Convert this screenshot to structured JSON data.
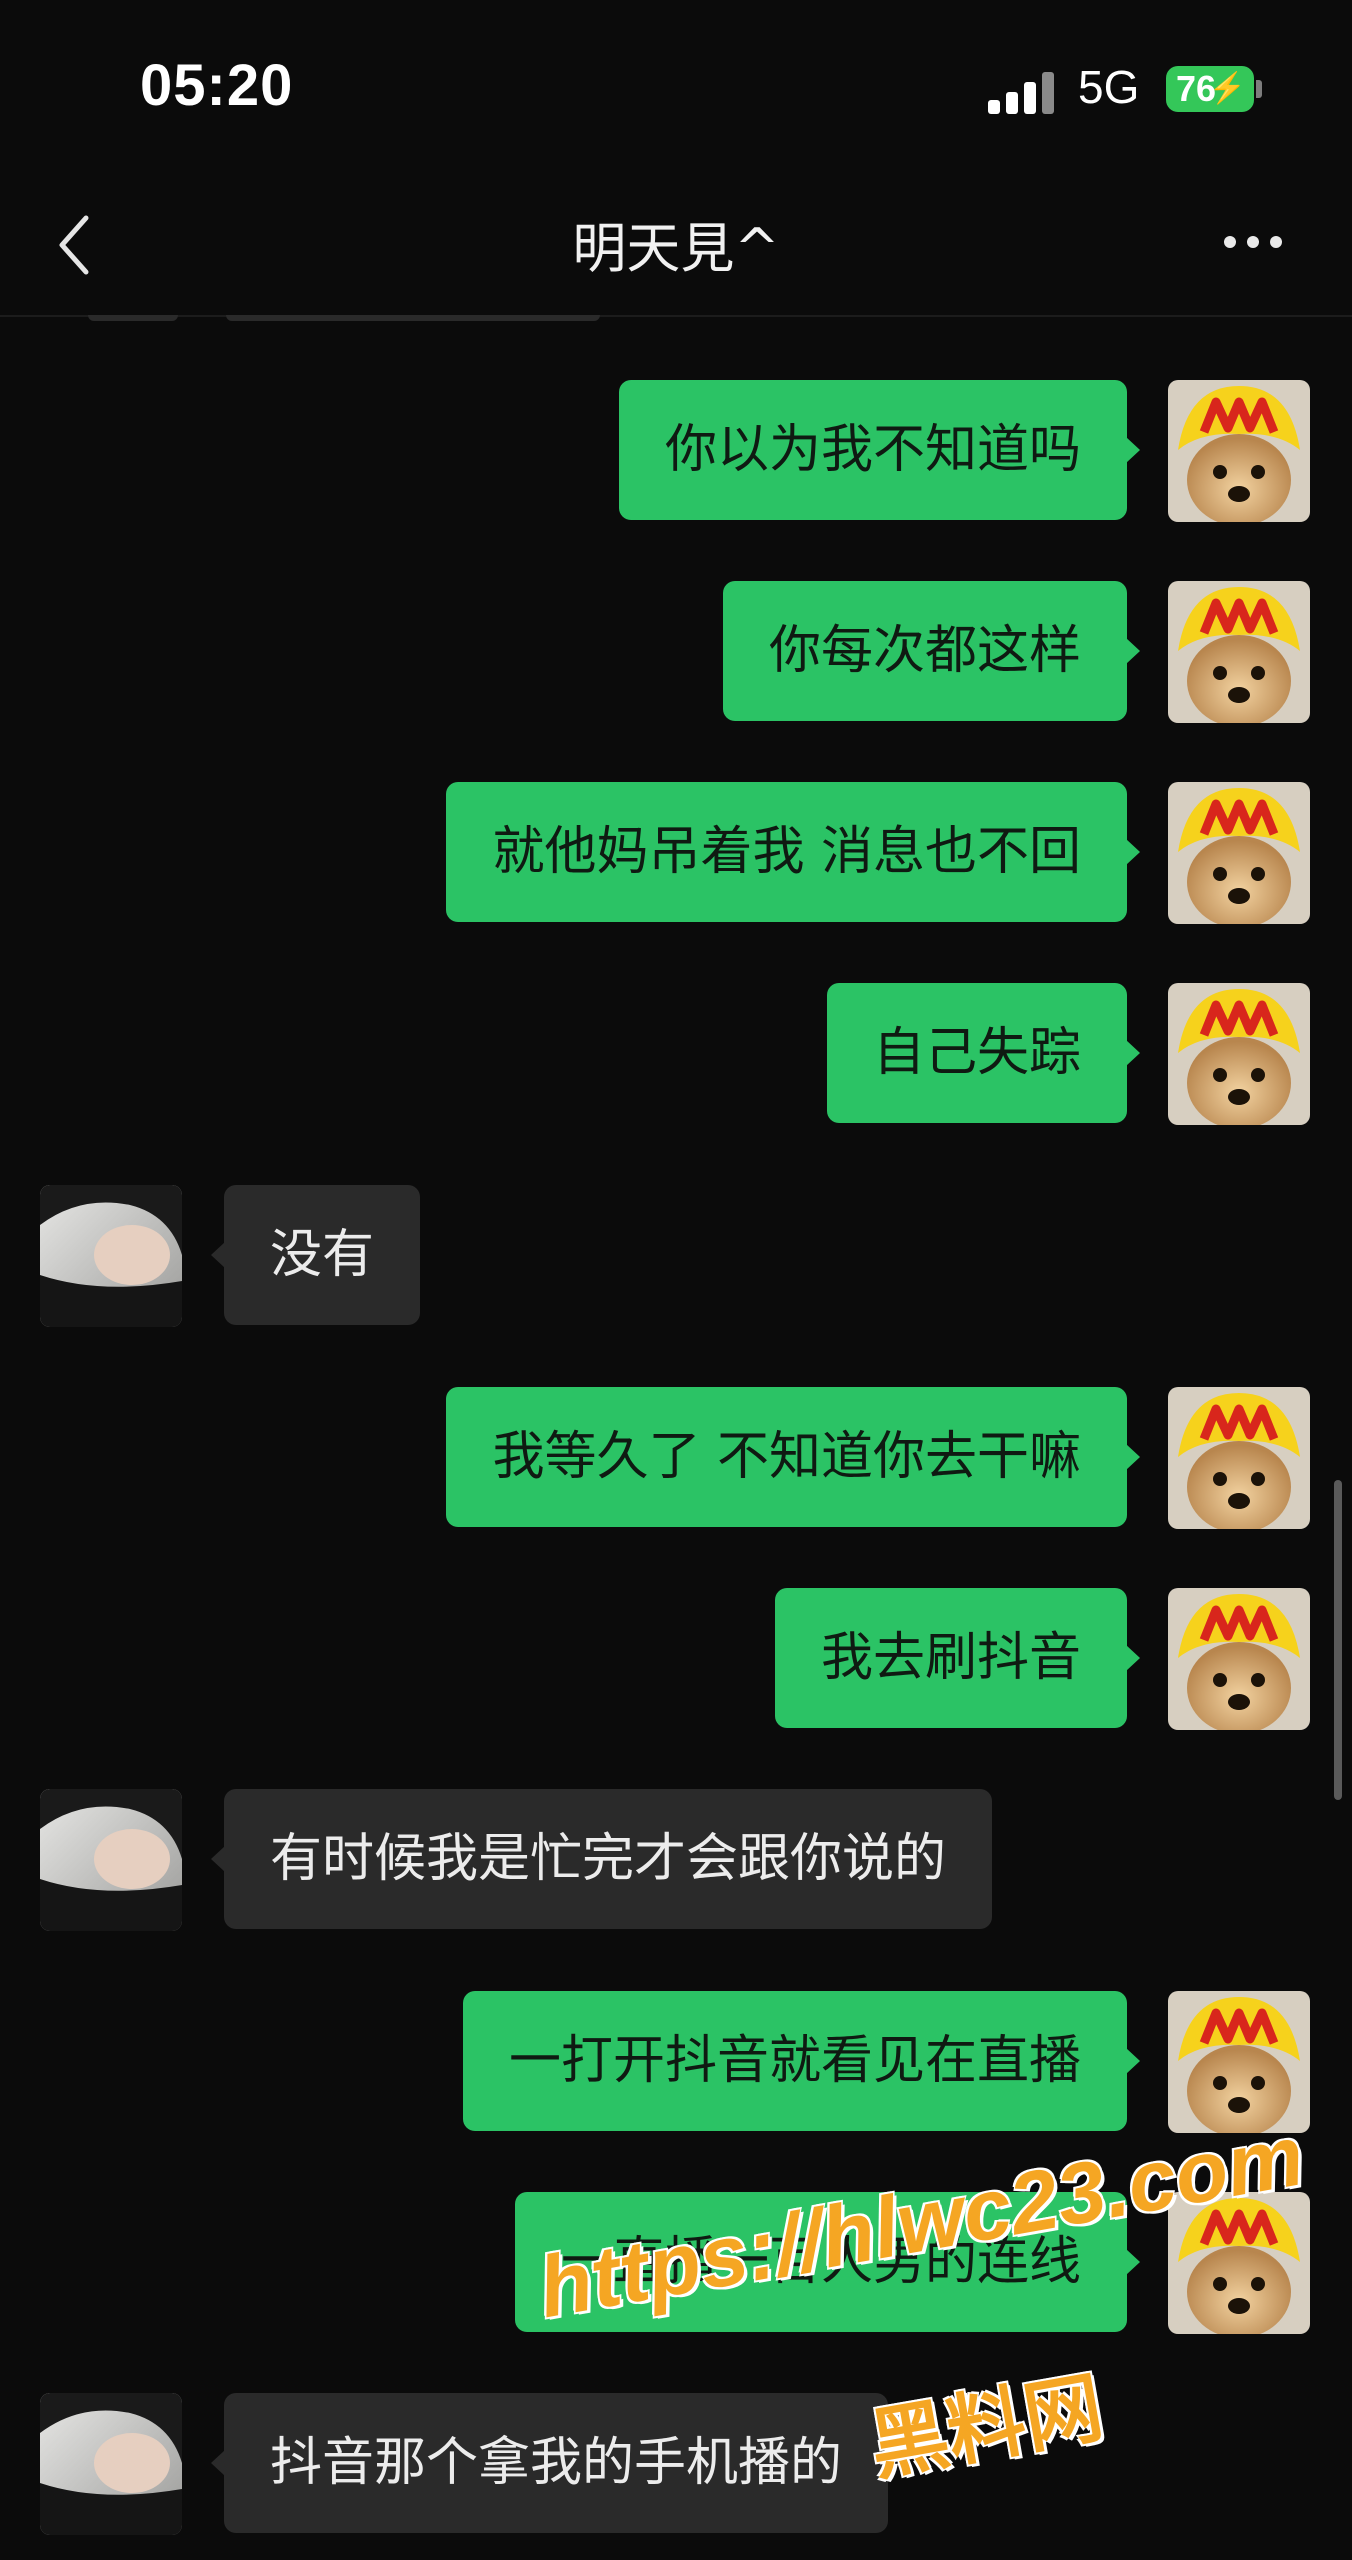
{
  "status_bar": {
    "time": "05:20",
    "network": "5G",
    "battery": "76"
  },
  "header": {
    "title": "明天見^",
    "back_icon": "chevron-left-icon",
    "more_icon": "more-dots-icon"
  },
  "messages": [
    {
      "sender": "me",
      "text": "你以为我不知道吗"
    },
    {
      "sender": "me",
      "text": "你每次都这样"
    },
    {
      "sender": "me",
      "text": "就他妈吊着我 消息也不回"
    },
    {
      "sender": "me",
      "text": "自己失踪"
    },
    {
      "sender": "them",
      "text": "没有"
    },
    {
      "sender": "me",
      "text": "我等久了 不知道你去干嘛"
    },
    {
      "sender": "me",
      "text": "我去刷抖音"
    },
    {
      "sender": "them",
      "text": "有时候我是忙完才会跟你说的"
    },
    {
      "sender": "me",
      "text": "一打开抖音就看见在直播"
    },
    {
      "sender": "me",
      "text": "一直播一百人男的连线"
    },
    {
      "sender": "them",
      "text": "抖音那个拿我的手机播的"
    }
  ],
  "watermark": {
    "url": "https://hlwc23.com",
    "site_name": "黑料网"
  },
  "colors": {
    "background": "#0b0b0b",
    "my_bubble": "#2bc365",
    "their_bubble": "#2a2a2a",
    "battery": "#34c759",
    "watermark": "#f5a623"
  }
}
